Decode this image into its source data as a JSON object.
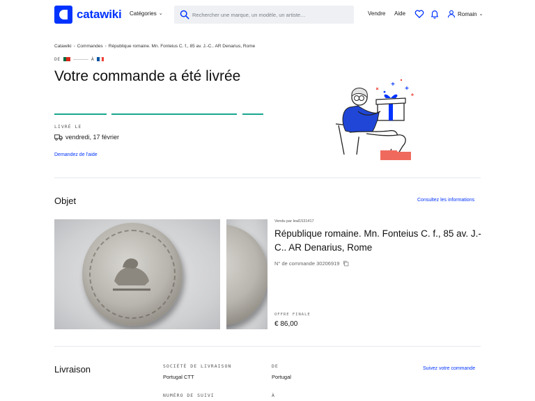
{
  "header": {
    "logo_text": "catawiki",
    "categories_label": "Catégories",
    "search_placeholder": "Rechercher une marque, un modèle, un artiste…",
    "sell_label": "Vendre",
    "help_label": "Aide",
    "user_name": "Romain",
    "brand_color": "#0033ff"
  },
  "breadcrumb": {
    "items": [
      "Catawiki",
      "Commandes",
      "République romaine. Mn. Fonteius C. f., 85 av. J.-C.. AR Denarius, Rome"
    ]
  },
  "route": {
    "from_label": "DE",
    "to_label": "À",
    "from_flag": "portugal-flag",
    "to_flag": "france-flag"
  },
  "status": {
    "title": "Votre commande a été livrée",
    "progress_color": "#17a68e",
    "delivered_label": "LIVRÉ LE",
    "delivered_date": "vendredi, 17 février",
    "help_link": "Demandez de l'aide"
  },
  "object_section": {
    "title": "Objet",
    "details_link": "Consultez les informations",
    "seller": "Vendu par leal1531417",
    "lot_title": "République romaine. Mn. Fonteius C. f., 85 av. J.-C.. AR Denarius, Rome",
    "order_number": "N° de commande 30206919",
    "final_offer_label": "OFFRE FINALE",
    "final_price": "€ 86,00"
  },
  "delivery_section": {
    "title": "Livraison",
    "carrier_label": "SOCIÉTÉ DE LIVRAISON",
    "carrier_value": "Portugal CTT",
    "from_label": "DE",
    "from_value": "Portugal",
    "tracking_label": "NUMÉRO DE SUIVI",
    "to_label": "À",
    "track_link": "Suivez votre commande"
  }
}
